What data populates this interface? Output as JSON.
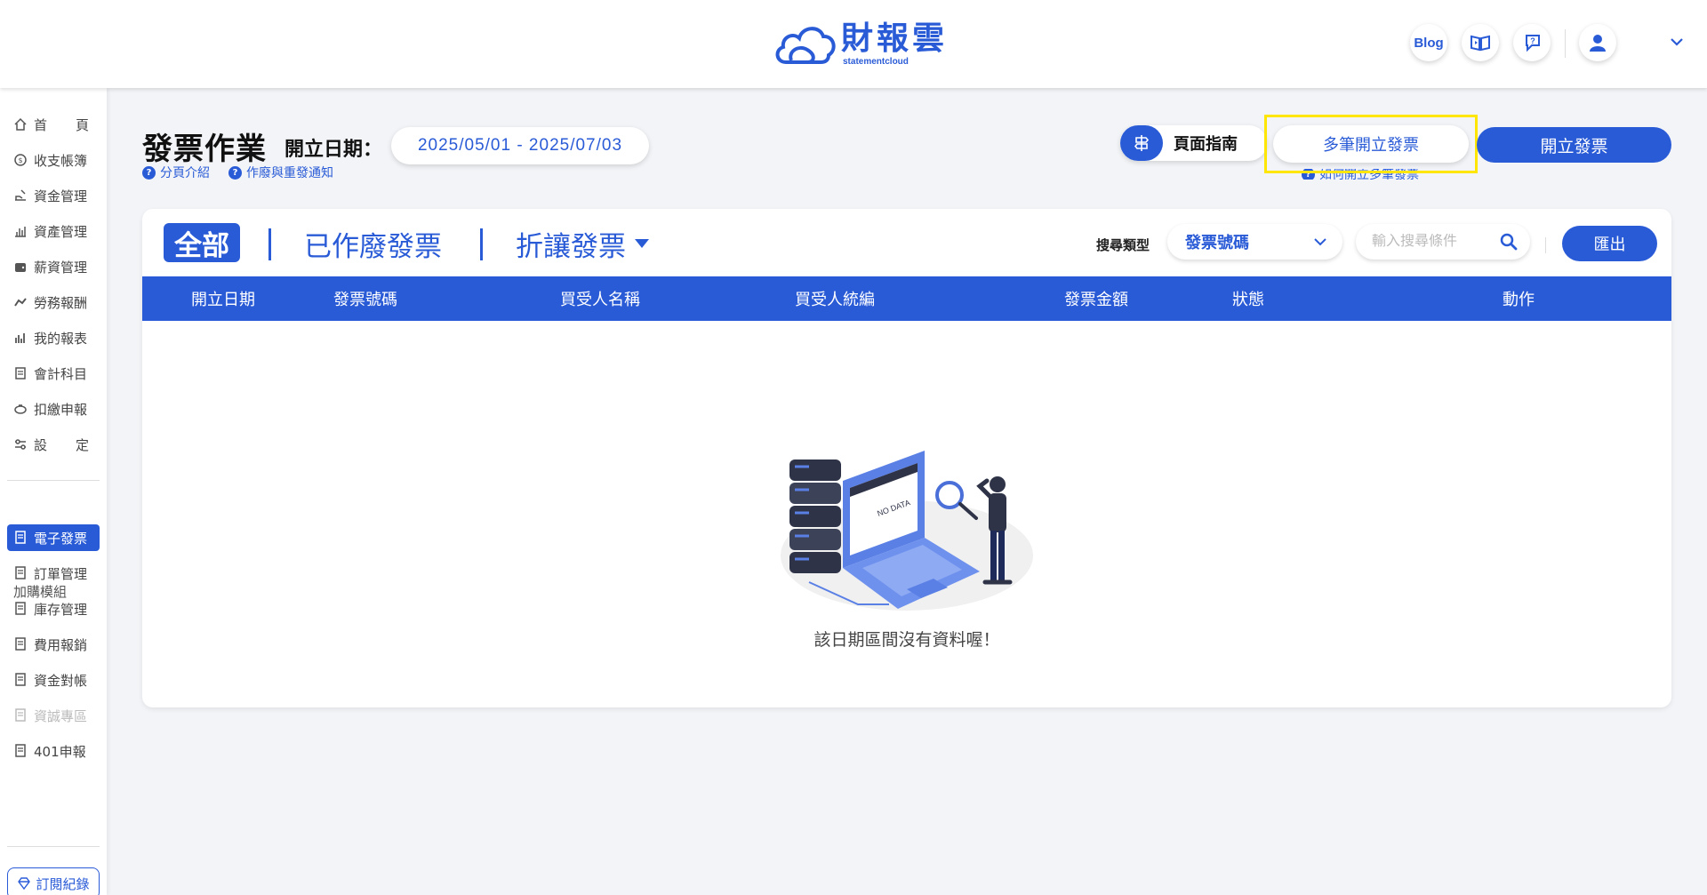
{
  "header": {
    "logo_text": "財報雲",
    "logo_sub": "statementcloud",
    "blog_label": "Blog",
    "icons": [
      "book-icon",
      "chat-question-icon",
      "user-icon",
      "chevron-down-icon"
    ]
  },
  "sidebar": {
    "items": [
      {
        "label_a": "首",
        "label_b": "頁",
        "icon": "home-icon"
      },
      {
        "label": "收支帳簿",
        "icon": "coin-icon"
      },
      {
        "label": "資金管理",
        "icon": "hand-money-icon"
      },
      {
        "label": "資產管理",
        "icon": "chart-bars-icon"
      },
      {
        "label": "薪資管理",
        "icon": "wallet-icon"
      },
      {
        "label": "勞務報酬",
        "icon": "handshake-icon"
      },
      {
        "label": "我的報表",
        "icon": "report-chart-icon"
      },
      {
        "label": "會計科目",
        "icon": "ledger-icon"
      },
      {
        "label": "扣繳申報",
        "icon": "piggy-icon"
      },
      {
        "label_a": "設",
        "label_b": "定",
        "icon": "sliders-icon"
      }
    ],
    "addon_heading": "加購模組",
    "addons": [
      {
        "label": "電子發票",
        "active": true
      },
      {
        "label": "訂單管理"
      },
      {
        "label": "庫存管理"
      },
      {
        "label": "費用報銷"
      },
      {
        "label": "資金對帳"
      },
      {
        "label": "資誠專區",
        "disabled": true
      },
      {
        "label": "401申報"
      }
    ],
    "subscription_label": "訂閱紀錄"
  },
  "page": {
    "title": "發票作業",
    "date_label": "開立日期：",
    "date_range": "2025/05/01 - 2025/07/03",
    "help_pagination": "分頁介紹",
    "help_void": "作廢與重發通知",
    "guide_label": "頁面指南",
    "multi_issue_label": "多筆開立發票",
    "multi_issue_help": "如何開立多筆發票",
    "issue_label": "開立發票"
  },
  "tabs": {
    "all": "全部",
    "voided": "已作廢發票",
    "discount": "折讓發票"
  },
  "search": {
    "type_label": "搜尋類型",
    "type_value": "發票號碼",
    "placeholder": "輸入搜尋條件",
    "export_label": "匯出"
  },
  "table": {
    "columns": [
      "開立日期",
      "發票號碼",
      "買受人名稱",
      "買受人統編",
      "發票金額",
      "狀態",
      "動作"
    ],
    "empty_message": "該日期區間沒有資料喔！",
    "empty_art_label": "NO DATA"
  },
  "colors": {
    "primary": "#2a5bd7",
    "highlight": "#ffe600"
  }
}
